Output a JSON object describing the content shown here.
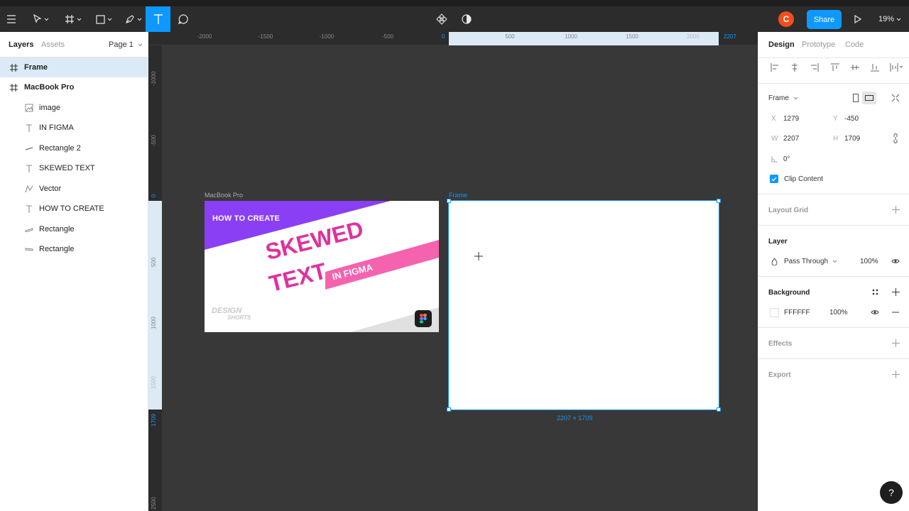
{
  "toolbar": {
    "share_label": "Share",
    "zoom_label": "19%",
    "avatar_initial": "C"
  },
  "left_panel": {
    "tabs": [
      {
        "label": "Layers",
        "active": true
      },
      {
        "label": "Assets",
        "active": false
      }
    ],
    "page_label": "Page 1",
    "layers": [
      {
        "name": "Frame",
        "icon": "frame-icon",
        "level": 0,
        "selected": true
      },
      {
        "name": "MacBook Pro",
        "icon": "frame-icon",
        "level": 0,
        "selected": false
      },
      {
        "name": "image",
        "icon": "image-icon",
        "level": 1
      },
      {
        "name": "IN FIGMA",
        "icon": "text-icon",
        "level": 1
      },
      {
        "name": "Rectangle 2",
        "icon": "line-icon",
        "level": 1
      },
      {
        "name": "SKEWED TEXT",
        "icon": "text-icon",
        "level": 1
      },
      {
        "name": "Vector",
        "icon": "vector-icon",
        "level": 1
      },
      {
        "name": "HOW TO CREATE",
        "icon": "text-icon",
        "level": 1
      },
      {
        "name": "Rectangle",
        "icon": "rectangle-icon",
        "level": 1
      },
      {
        "name": "Rectangle",
        "icon": "rectangle-icon",
        "level": 1
      }
    ]
  },
  "rulers": {
    "top": [
      "-2000",
      "-1500",
      "-1000",
      "-500",
      "0",
      "500",
      "1000",
      "1500",
      "2000",
      "2207"
    ],
    "left": [
      "-1000",
      "-500",
      "0",
      "500",
      "1000",
      "1500",
      "1709",
      "2500"
    ]
  },
  "canvas": {
    "macbook_label": "MacBook Pro",
    "frame_label": "Frame",
    "frame_dims": "2207 × 1709",
    "thumbnail": {
      "heading": "HOW TO CREATE",
      "line1": "SKEWED",
      "line2": "TEXT",
      "banner": "IN FIGMA",
      "watermark_1": "DESIGN",
      "watermark_2": "SHORTS"
    }
  },
  "right_panel": {
    "tabs": [
      {
        "label": "Design",
        "active": true
      },
      {
        "label": "Prototype",
        "active": false
      },
      {
        "label": "Code",
        "active": false
      }
    ],
    "frame_preset": "Frame",
    "x_label": "X",
    "x_value": "1279",
    "y_label": "Y",
    "y_value": "-450",
    "w_label": "W",
    "w_value": "2207",
    "h_label": "H",
    "h_value": "1709",
    "rotation_value": "0°",
    "clip_content_label": "Clip Content",
    "clip_content_checked": true,
    "layout_grid_label": "Layout Grid",
    "layer_label": "Layer",
    "blend_mode": "Pass Through",
    "layer_opacity": "100%",
    "background_label": "Background",
    "bg_hex": "FFFFFF",
    "bg_opacity": "100%",
    "effects_label": "Effects",
    "export_label": "Export"
  },
  "colors": {
    "accent": "#0d99ff",
    "avatar": "#f24e1e",
    "thumb_purple": "#8a3ff5",
    "thumb_pink": "#e0309e"
  },
  "help_label": "?"
}
